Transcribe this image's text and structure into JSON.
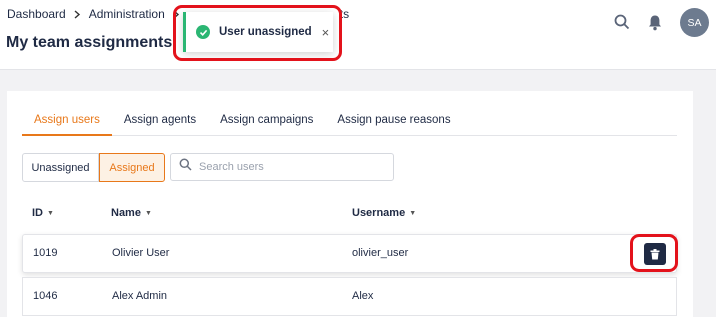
{
  "breadcrumb": {
    "items": [
      "Dashboard",
      "Administration"
    ],
    "trailing_fragment": "ts"
  },
  "page_title": "My team assignments",
  "toast": {
    "message": "User unassigned",
    "close_glyph": "×",
    "status_color": "#2bb673"
  },
  "user": {
    "initials": "SA"
  },
  "tabs": [
    {
      "label": "Assign users",
      "active": true
    },
    {
      "label": "Assign agents",
      "active": false
    },
    {
      "label": "Assign campaigns",
      "active": false
    },
    {
      "label": "Assign pause reasons",
      "active": false
    }
  ],
  "filter": {
    "unassigned_label": "Unassigned",
    "assigned_label": "Assigned",
    "selected": "Assigned"
  },
  "search": {
    "placeholder": "Search users",
    "value": ""
  },
  "table": {
    "columns": [
      "ID",
      "Name",
      "Username"
    ],
    "rows": [
      {
        "id": "1019",
        "name": "Olivier User",
        "username": "olivier_user"
      },
      {
        "id": "1046",
        "name": "Alex Admin",
        "username": "Alex"
      }
    ]
  },
  "colors": {
    "accent": "#e8781a",
    "highlight": "#e3121b",
    "navy": "#1f2a44"
  },
  "icons": [
    "chevron-right-icon",
    "check-circle-icon",
    "close-icon",
    "search-icon",
    "bell-icon",
    "sort-caret-icon",
    "trash-icon"
  ]
}
